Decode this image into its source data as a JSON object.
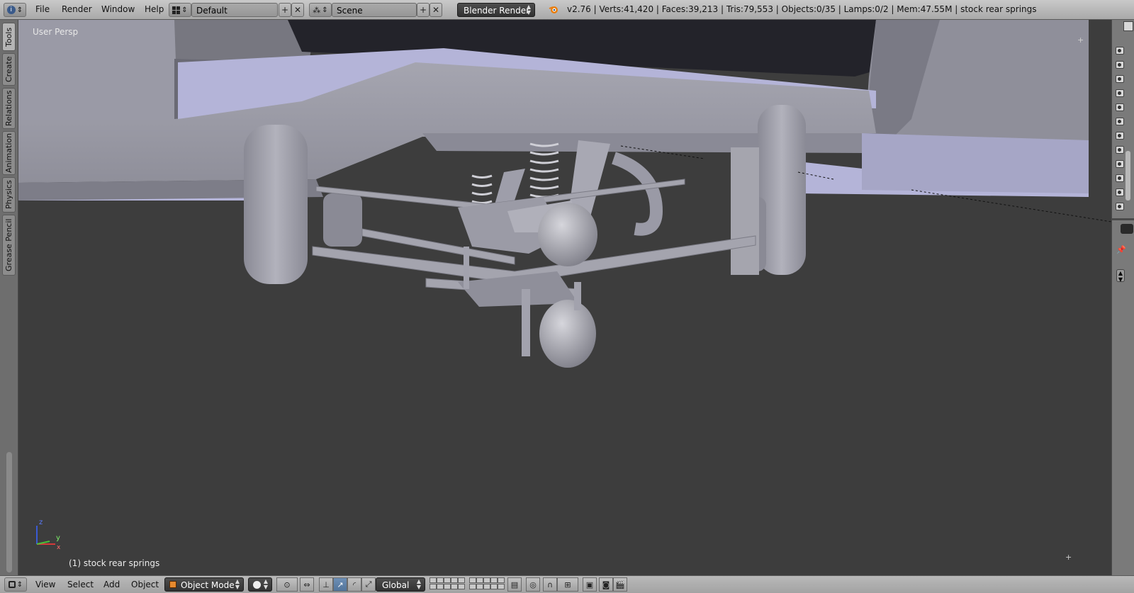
{
  "header": {
    "menus": [
      "File",
      "Render",
      "Window",
      "Help"
    ],
    "screen_layout": "Default",
    "scene": "Scene",
    "render_engine": "Blender Render",
    "stats": "v2.76 | Verts:41,420 | Faces:39,213 | Tris:79,553 | Objects:0/35 | Lamps:0/2 | Mem:47.55M | stock rear springs"
  },
  "viewport": {
    "view_label": "User Persp",
    "object_label": "(1) stock rear springs",
    "axis_labels": {
      "x": "x",
      "y": "y",
      "z": "z"
    }
  },
  "toolshelf_tabs": [
    "Tools",
    "Create",
    "Relations",
    "Animation",
    "Physics",
    "Grease Pencil"
  ],
  "footer": {
    "menus": [
      "View",
      "Select",
      "Add",
      "Object"
    ],
    "mode": "Object Mode",
    "orientation": "Global"
  },
  "colors": {
    "header_bg": "#b3b3b3",
    "viewport_bg": "#3d3d3d",
    "model_gray": "#9a9aa6",
    "model_highlight": "#b4b4d8",
    "dropdown_dark": "#3a3a3a"
  },
  "icons": {
    "info_editor": "info-icon",
    "layout": "screen-layout-icon",
    "scene": "scene-icon",
    "blender_logo": "blender-logo-icon",
    "view3d": "view3d-icon",
    "shading": "solid-shading-icon",
    "pivot": "pivot-icon",
    "manipulator": "manipulator-icon",
    "render": "render-icon"
  }
}
